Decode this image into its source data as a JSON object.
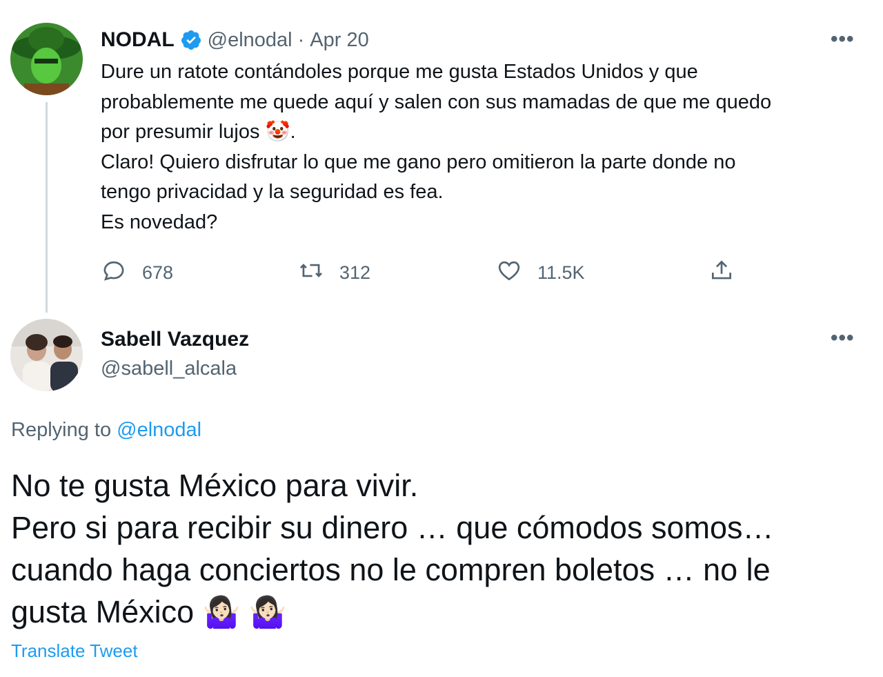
{
  "tweet": {
    "author_name": "NODAL",
    "verified_icon": "verified-badge-icon",
    "handle": "@elnodal",
    "separator": "·",
    "date": "Apr 20",
    "more_label": "•••",
    "text_part1": "Dure un ratote contándoles porque me gusta Estados Unidos y que\nprobablemente me quede aquí y salen con sus mamadas de que me quedo\npor presumir lujos ",
    "text_emoji": "🤡",
    "text_part2": ".\nClaro! Quiero disfrutar lo que me gano pero omitieron la parte donde no\ntengo privacidad y la seguridad es fea.\nEs novedad?",
    "stats": {
      "replies": "678",
      "retweets": "312",
      "likes": "11.5K"
    }
  },
  "reply": {
    "author_name": "Sabell Vazquez",
    "handle": "@sabell_alcala",
    "more_label": "•••",
    "replying_to_label": "Replying to",
    "replying_to_handle": "@elnodal",
    "text": "No te gusta México para vivir.\nPero si para recibir su  dinero …  que cómodos somos…\ncuando haga conciertos no le compren boletos …  no le\ngusta México ",
    "text_emojis": "🤷🏻‍♀️ 🤷🏻‍♀️",
    "translate_label": "Translate Tweet"
  },
  "colors": {
    "accent": "#1d9bf0",
    "text": "#0f1419",
    "muted": "#536471"
  }
}
